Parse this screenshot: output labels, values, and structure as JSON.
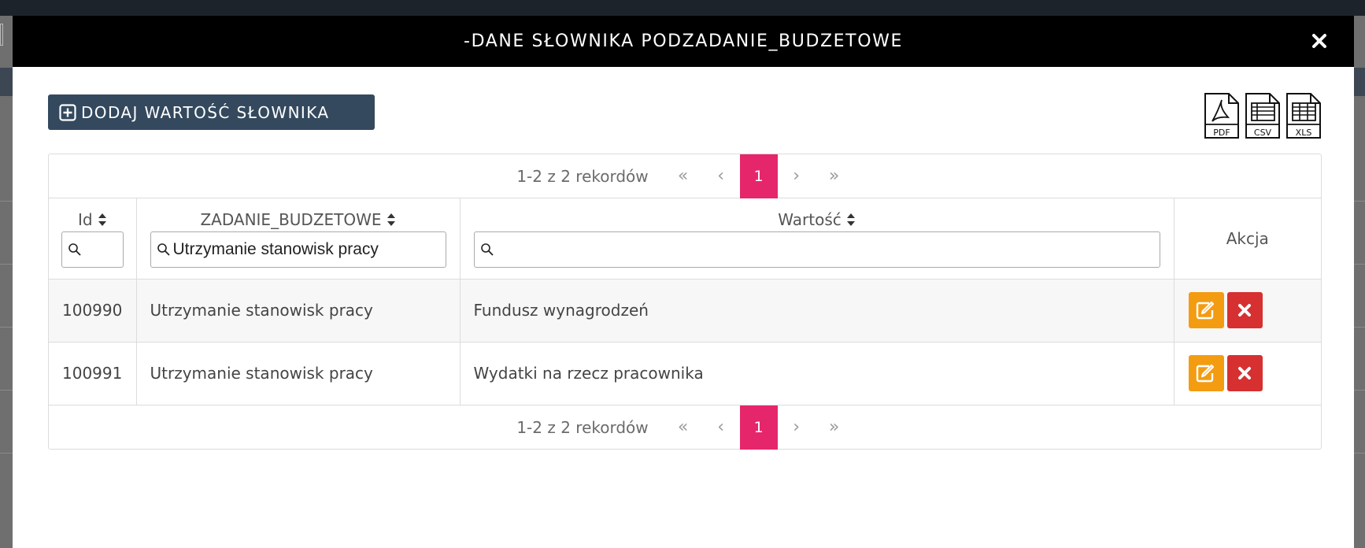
{
  "modal": {
    "title": "-DANE SŁOWNIKA PODZADANIE_BUDZETOWE",
    "close_icon": "close-icon"
  },
  "toolbar": {
    "add_label": "DODAJ WARTOŚĆ SŁOWNIKA",
    "exports": [
      {
        "label": "PDF",
        "icon": "pdf-file-icon"
      },
      {
        "label": "CSV",
        "icon": "csv-file-icon"
      },
      {
        "label": "XLS",
        "icon": "xls-file-icon"
      }
    ]
  },
  "pager": {
    "info": "1-2 z 2 rekordów",
    "first": "«",
    "prev": "‹",
    "current": "1",
    "next": "›",
    "last": "»"
  },
  "table": {
    "columns": [
      {
        "label": "Id",
        "filter_value": ""
      },
      {
        "label": "ZADANIE_BUDZETOWE",
        "filter_value": "Utrzymanie stanowisk pracy"
      },
      {
        "label": "Wartość",
        "filter_value": ""
      },
      {
        "label": "Akcja"
      }
    ],
    "rows": [
      {
        "id": "100990",
        "zadanie": "Utrzymanie stanowisk pracy",
        "wartosc": "Fundusz wynagrodzeń"
      },
      {
        "id": "100991",
        "zadanie": "Utrzymanie stanowisk pracy",
        "wartosc": "Wydatki na rzecz pracownika"
      }
    ]
  },
  "colors": {
    "header_bg": "#000000",
    "add_button_bg": "#34495e",
    "pager_active": "#e6266b",
    "edit_button": "#f39c12",
    "delete_button": "#d63031"
  }
}
